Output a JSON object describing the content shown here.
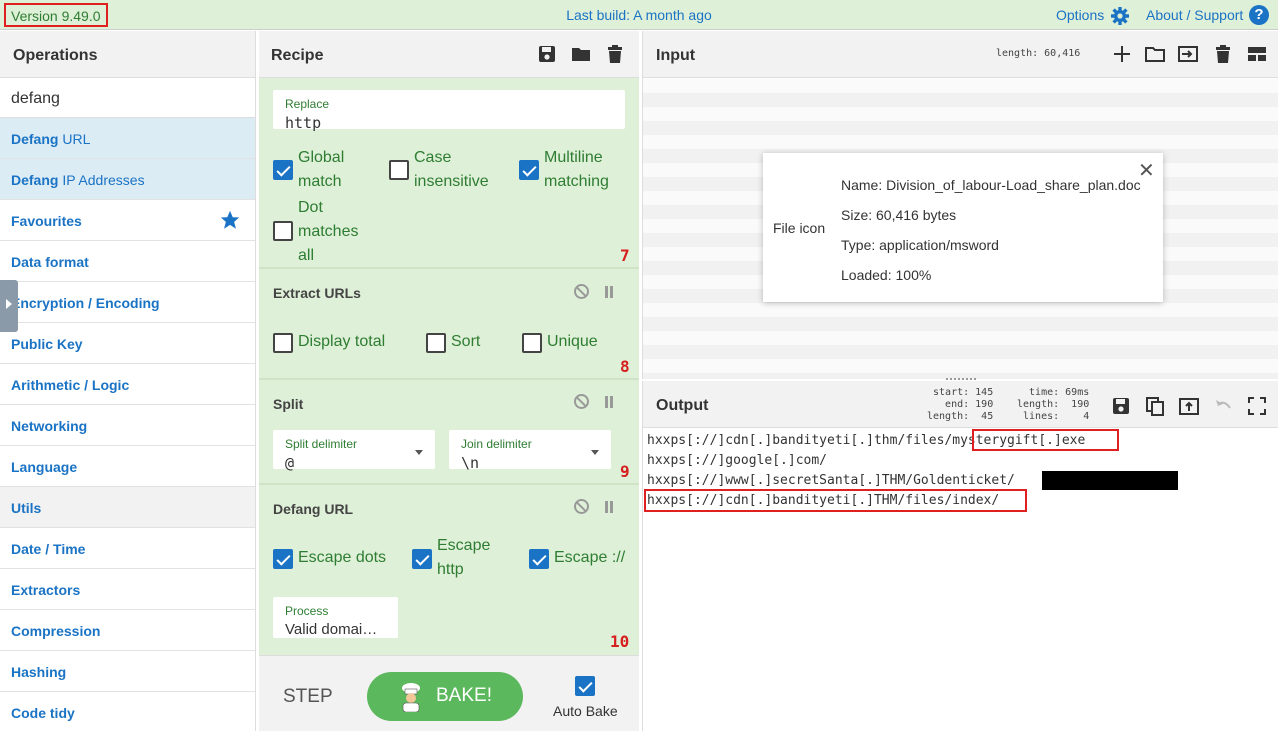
{
  "banner": {
    "version": "Version 9.49.0",
    "last_build": "Last build: A month ago",
    "options": "Options",
    "about": "About / Support",
    "help_glyph": "?"
  },
  "operations": {
    "title": "Operations",
    "search_value": "defang",
    "results": [
      {
        "match": "Defang",
        "rest": " URL"
      },
      {
        "match": "Defang",
        "rest": " IP Addresses"
      }
    ],
    "categories": [
      "Favourites",
      "Data format",
      "Encryption / Encoding",
      "Public Key",
      "Arithmetic / Logic",
      "Networking",
      "Language",
      "Utils",
      "Date / Time",
      "Extractors",
      "Compression",
      "Hashing",
      "Code tidy"
    ]
  },
  "recipe": {
    "title": "Recipe",
    "replace": {
      "label": "Replace",
      "value": "http",
      "global_match": [
        "Global",
        "match"
      ],
      "case_insensitive": [
        "Case",
        "insensitive"
      ],
      "multiline": [
        "Multiline",
        "matching"
      ],
      "dot_matches": [
        "Dot",
        "matches",
        "all"
      ],
      "number": "7"
    },
    "extract_urls": {
      "title": "Extract URLs",
      "display_total": "Display total",
      "sort": "Sort",
      "unique": "Unique",
      "number": "8"
    },
    "split": {
      "title": "Split",
      "split_label": "Split delimiter",
      "split_value": "@",
      "join_label": "Join delimiter",
      "join_value": "\\n",
      "number": "9"
    },
    "defang_url": {
      "title": "Defang URL",
      "escape_dots": "Escape dots",
      "escape_http": [
        "Escape",
        "http"
      ],
      "escape_proto": "Escape ://",
      "process_label": "Process",
      "process_value": "Valid domai…",
      "number": "10"
    },
    "controls": {
      "step": "STEP",
      "bake": "BAKE!",
      "auto_bake": "Auto Bake"
    }
  },
  "input": {
    "title": "Input",
    "length": "length: 60,416",
    "file": {
      "icon_label": "File icon",
      "name": "Name: Division_of_labour-Load_share_plan.doc",
      "size": "Size: 60,416 bytes",
      "type": "Type: application/msword",
      "loaded": "Loaded: 100%",
      "close": "✕"
    }
  },
  "output": {
    "title": "Output",
    "stats_col1": "start: 145\n  end: 190\nlength:  45",
    "stats_col2": "time: 69ms\nlength:  190\nlines:    4",
    "lines": [
      "hxxps[://]cdn[.]bandityeti[.]thm/files/mysterygift[.]exe",
      "hxxps[://]google[.]com/",
      "hxxps[://]www[.]secretSanta[.]THM/Goldenticket/",
      "hxxps[://]cdn[.]bandityeti[.]THM/files/index/"
    ]
  },
  "colors": {
    "banner_bg": "#dff0d8",
    "link_blue": "#1a73c4",
    "highlight_red": "#e02020",
    "bake_green": "#5cb85c"
  }
}
